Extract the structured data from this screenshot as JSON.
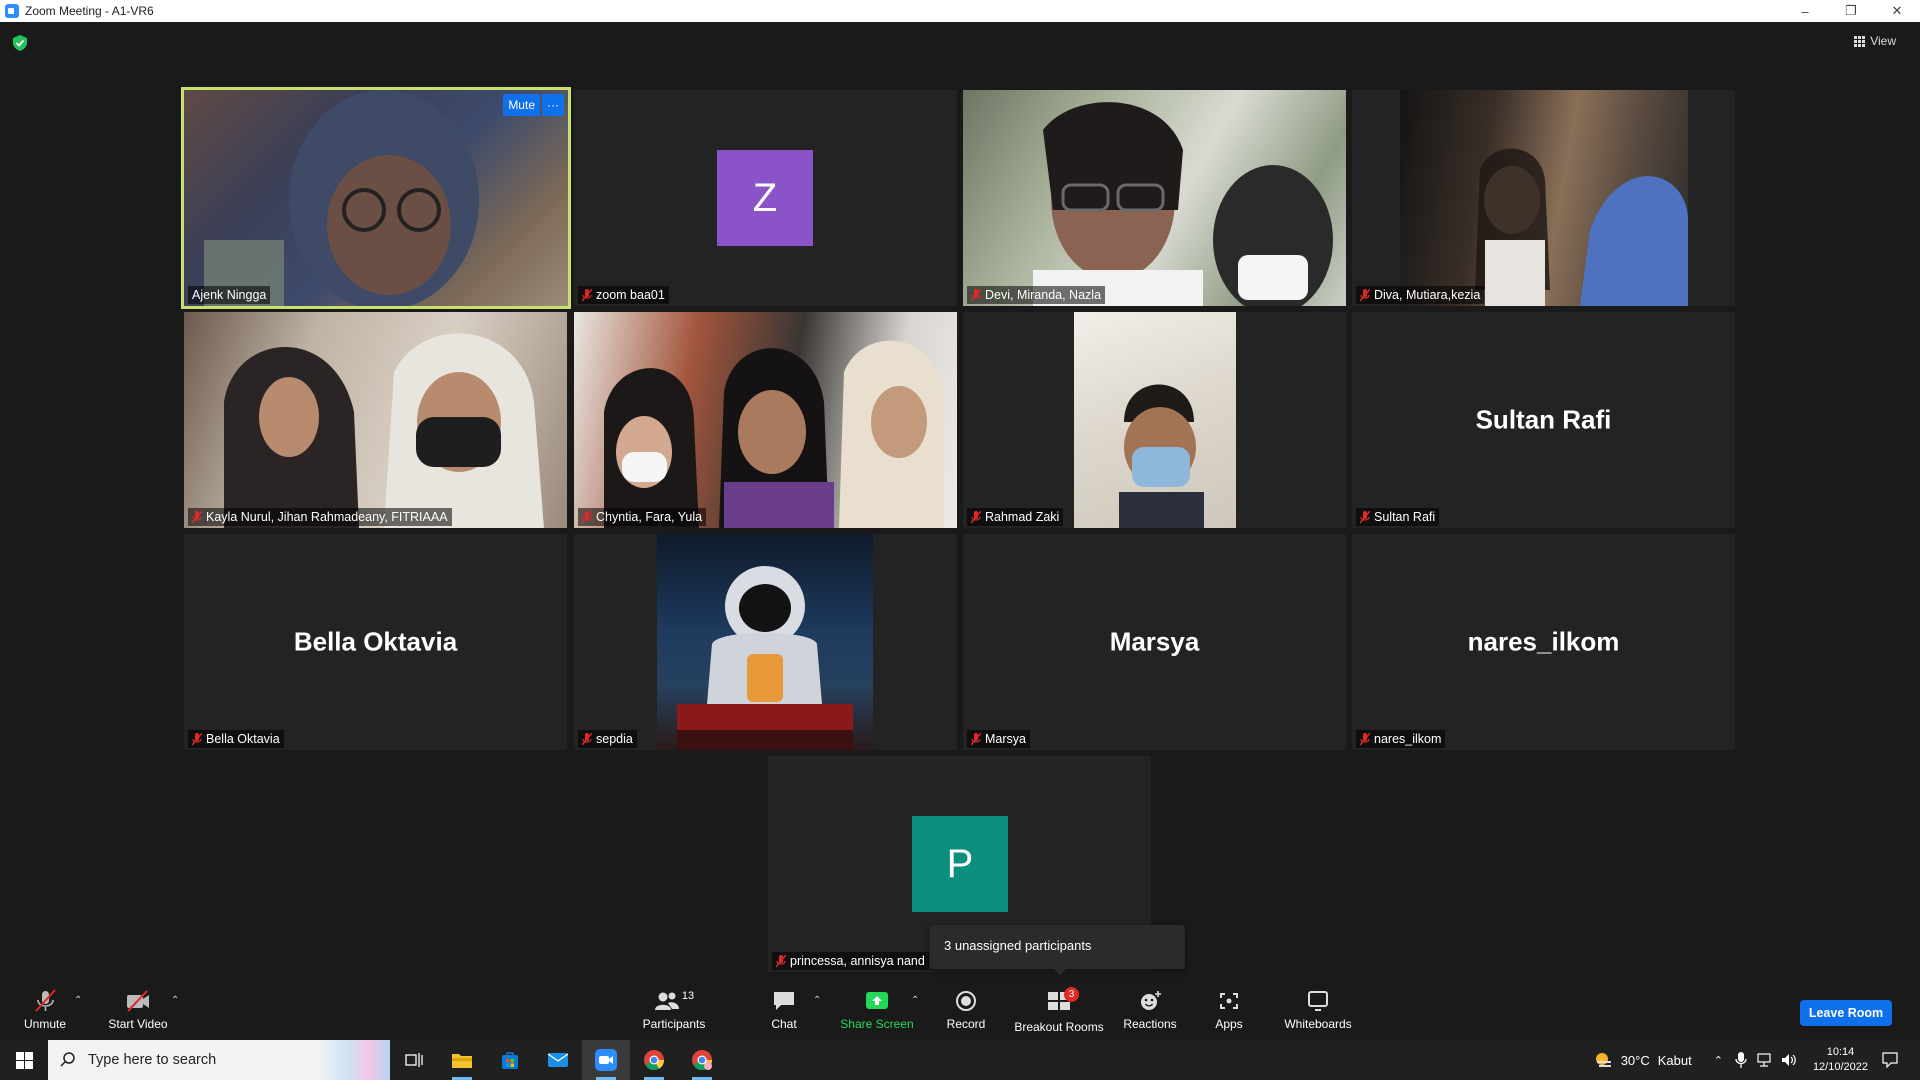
{
  "window": {
    "title": "Zoom Meeting - A1-VR6"
  },
  "top": {
    "view_label": "View"
  },
  "tiles": [
    {
      "name": "Ajenk Ningga",
      "active": true,
      "mute_label": "Mute",
      "more_label": "···"
    },
    {
      "name": "zoom baa01",
      "avatar_letter": "Z",
      "avatar_color": "#8a54c8"
    },
    {
      "name": "Devi, Miranda, Nazla"
    },
    {
      "name": "Diva, Mutiara,kezia"
    },
    {
      "name": "Kayla Nurul, Jihan Rahmadeany, FITRIAAA"
    },
    {
      "name": "Chyntia, Fara, Yula"
    },
    {
      "name": "Rahmad Zaki"
    },
    {
      "name": "Sultan Rafi",
      "big_name": "Sultan Rafi"
    },
    {
      "name": "Bella Oktavia",
      "big_name": "Bella Oktavia"
    },
    {
      "name": "sepdia"
    },
    {
      "name": "Marsya",
      "big_name": "Marsya"
    },
    {
      "name": "nares_ilkom",
      "big_name": "nares_ilkom"
    },
    {
      "name": "princessa, annisya nand",
      "avatar_letter": "P",
      "avatar_color": "#0c8f7e"
    }
  ],
  "tooltip": {
    "text": "3 unassigned participants"
  },
  "toolbar": {
    "unmute": "Unmute",
    "start_video": "Start Video",
    "participants": "Participants",
    "participants_count": "13",
    "chat": "Chat",
    "share_screen": "Share Screen",
    "record": "Record",
    "breakout_rooms": "Breakout Rooms",
    "breakout_badge": "3",
    "reactions": "Reactions",
    "apps": "Apps",
    "whiteboards": "Whiteboards",
    "leave": "Leave Room"
  },
  "taskbar": {
    "search_placeholder": "Type here to search",
    "temperature": "30°C",
    "weather": "Kabut",
    "time": "10:14",
    "date": "12/10/2022"
  },
  "colors": {
    "accent": "#0e71eb",
    "active_border": "#c7e16a",
    "share_green": "#23d959",
    "mute_red": "#e02828"
  }
}
